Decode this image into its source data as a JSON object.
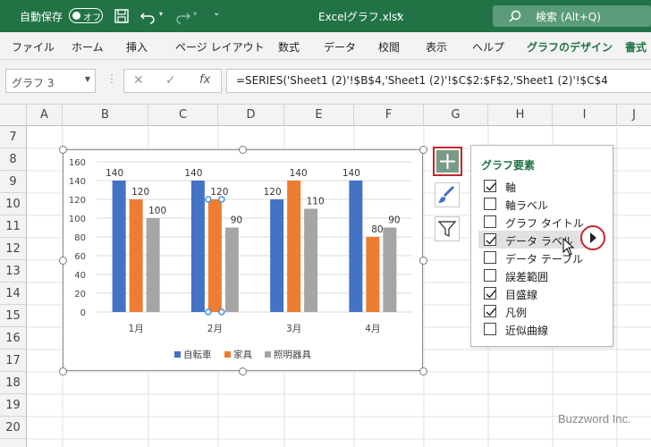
{
  "titlebar": {
    "autosave_label": "自動保存",
    "autosave_state": "オフ",
    "filename": "Excelグラフ.xlsx",
    "search_placeholder": "検索 (Alt+Q)"
  },
  "ribbon": {
    "tabs": [
      "ファイル",
      "ホーム",
      "挿入",
      "ページ レイアウト",
      "数式",
      "データ",
      "校閲",
      "表示",
      "ヘルプ",
      "グラフのデザイン",
      "書式"
    ]
  },
  "formula": {
    "name_box": "グラフ 3",
    "fx": "fx",
    "content": "=SERIES('Sheet1 (2)'!$B$4,'Sheet1 (2)'!$C$2:$F$2,'Sheet1 (2)'!$C$4"
  },
  "columns": [
    "A",
    "B",
    "C",
    "D",
    "E",
    "F",
    "G",
    "H",
    "I",
    "J"
  ],
  "rows": [
    "7",
    "8",
    "9",
    "10",
    "11",
    "12",
    "13",
    "14",
    "15",
    "16",
    "17",
    "18",
    "19",
    "20"
  ],
  "chart_data": {
    "type": "bar",
    "categories": [
      "1月",
      "2月",
      "3月",
      "4月"
    ],
    "series": [
      {
        "name": "自転車",
        "values": [
          140,
          140,
          120,
          140
        ],
        "color": "#4472c4"
      },
      {
        "name": "家具",
        "values": [
          120,
          120,
          140,
          80
        ],
        "color": "#ed7d31"
      },
      {
        "name": "照明器具",
        "values": [
          100,
          90,
          110,
          90
        ],
        "color": "#a5a5a5"
      }
    ],
    "yticks": [
      "160",
      "140",
      "120",
      "100",
      "80",
      "60",
      "40",
      "20",
      "0"
    ],
    "ylim": [
      0,
      160
    ],
    "legend": "bottom",
    "grid": true,
    "data_labels": true,
    "selected_series": "家具"
  },
  "panel": {
    "title": "グラフ要素",
    "items": [
      {
        "label": "軸",
        "checked": true
      },
      {
        "label": "軸ラベル",
        "checked": false
      },
      {
        "label": "グラフ タイトル",
        "checked": false
      },
      {
        "label": "データ ラベル",
        "checked": true
      },
      {
        "label": "データ テーブル",
        "checked": false
      },
      {
        "label": "誤差範囲",
        "checked": false
      },
      {
        "label": "目盛線",
        "checked": true
      },
      {
        "label": "凡例",
        "checked": true
      },
      {
        "label": "近似曲線",
        "checked": false
      }
    ]
  },
  "side_buttons": [
    "plus-icon",
    "brush-icon",
    "filter-icon"
  ],
  "watermark": "Buzzword Inc."
}
